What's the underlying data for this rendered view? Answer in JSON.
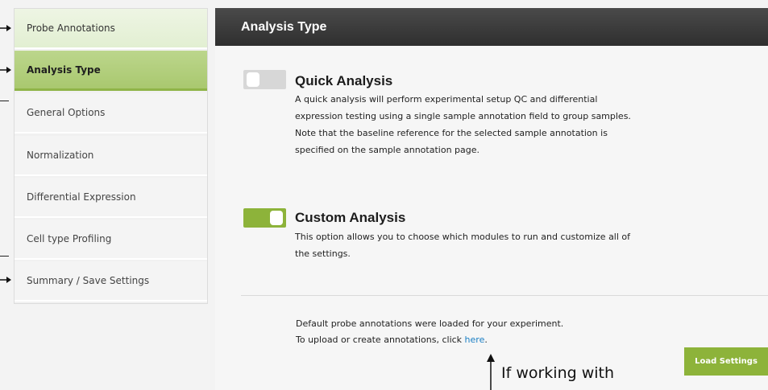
{
  "sidebar": {
    "items": [
      {
        "label": "Probe Annotations"
      },
      {
        "label": "Analysis Type"
      },
      {
        "label": "General Options"
      },
      {
        "label": "Normalization"
      },
      {
        "label": "Differential Expression"
      },
      {
        "label": "Cell type Profiling"
      },
      {
        "label": "Summary / Save Settings"
      }
    ],
    "active_item": "Analysis Type"
  },
  "panel": {
    "title": "Analysis Type",
    "options": [
      {
        "title": "Quick Analysis",
        "enabled": false,
        "description_lines": [
          "A quick analysis will perform experimental setup QC and differential",
          "expression testing using a single sample annotation field to group samples.",
          "Note that the baseline reference for the selected sample annotation is",
          "specified on the sample annotation page."
        ]
      },
      {
        "title": "Custom Analysis",
        "enabled": true,
        "description_lines": [
          "This option allows you to choose which modules to run and customize all of",
          "the settings."
        ]
      }
    ],
    "footer": {
      "line1": "Default probe annotations were loaded for your experiment.",
      "line2_prefix": "To upload or create annotations, click ",
      "link_text": "here",
      "line2_suffix": "."
    },
    "load_button_label": "Load Settings"
  },
  "annotation": {
    "callout_text": "If working with"
  },
  "colors": {
    "accent_green": "#8db33a",
    "header_dark": "#3a3a3a",
    "link_blue": "#1b7fc4"
  }
}
